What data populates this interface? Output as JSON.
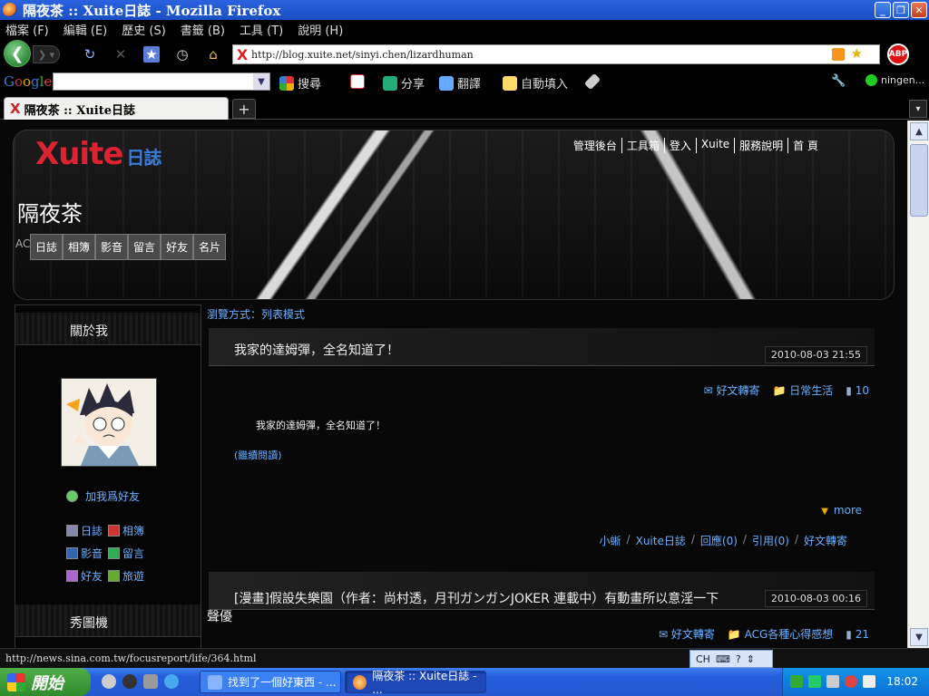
{
  "window": {
    "title": "隔夜茶 :: Xuite日誌 - Mozilla Firefox"
  },
  "menu": [
    "檔案 (F)",
    "編輯 (E)",
    "歷史 (S)",
    "書籤 (B)",
    "工具 (T)",
    "說明 (H)"
  ],
  "nav": {
    "url": "http://blog.xuite.net/sinyi.chen/lizardhuman"
  },
  "gtoolbar": {
    "logo": "Google",
    "search_label": "搜尋",
    "share_label": "分享",
    "translate_label": "翻譯",
    "autofill_label": "自動填入",
    "user_label": "ningen..."
  },
  "tabs": [
    {
      "label": "隔夜茶 :: Xuite日誌"
    }
  ],
  "page": {
    "logo_text": "Xuite",
    "logo_sub": "日誌",
    "topnav": [
      "管理後台",
      "工具箱",
      "登入",
      "Xuite",
      "服務說明",
      "首 頁"
    ],
    "blog_title": "隔夜茶",
    "blog_sub": "AC",
    "blog_tabs": [
      "日誌",
      "相簿",
      "影音",
      "留言",
      "好友",
      "名片"
    ],
    "sidebar": {
      "about_heading": "關於我",
      "add_friend": "加我爲好友",
      "links": [
        "日誌",
        "相簿",
        "影音",
        "留言",
        "好友",
        "旅遊"
      ],
      "gallery_heading": "秀圖機"
    },
    "view_mode": "瀏覽方式：列表模式",
    "post1": {
      "title": "我家的達姆彈，全名知道了！",
      "date": "2010-08-03 21:55",
      "share": "好文轉寄",
      "category": "日常生活",
      "count": "10",
      "body": "我家的達姆彈，全名知道了！",
      "read_more": "(繼續閱讀)",
      "more": "more",
      "footer": [
        "小蜥",
        "Xuite日誌",
        "回應(0)",
        "引用(0)",
        "好文轉寄"
      ]
    },
    "post2": {
      "title": "[漫畫]假設失樂園（作者：尚村透，月刊ガンガンJOKER 連載中）有動畫所以意淫一下",
      "title_extra": "聲優",
      "date": "2010-08-03 00:16",
      "share": "好文轉寄",
      "category": "ACG各種心得感想",
      "count": "21"
    }
  },
  "status": {
    "text": "http://news.sina.com.tw/focusreport/life/364.html",
    "ime": "CH"
  },
  "taskbar": {
    "start": "開始",
    "tasks": [
      {
        "label": "找到了一個好東西 - ..."
      },
      {
        "label": "隔夜茶 :: Xuite日誌 - ..."
      }
    ],
    "clock": "18:02"
  }
}
